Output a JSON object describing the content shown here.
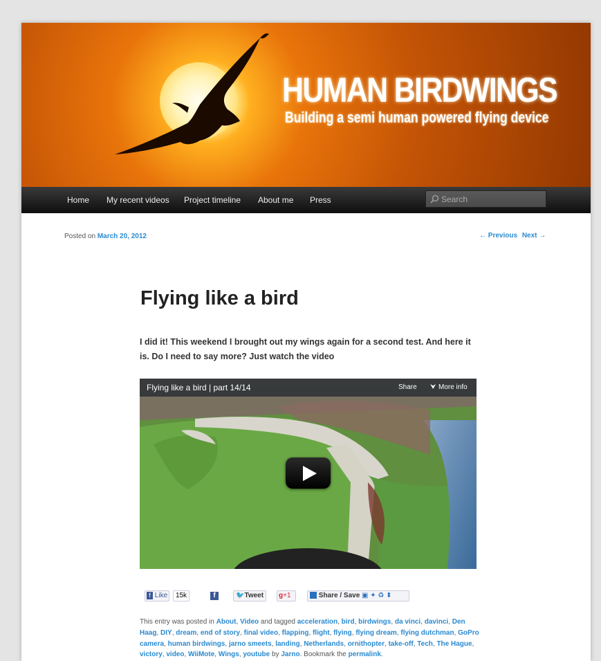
{
  "header": {
    "site_title": "HUMAN BIRDWINGS",
    "site_description": "Building a semi human powered flying device"
  },
  "nav": {
    "items": [
      "Home",
      "My recent videos",
      "Project timeline",
      "About me",
      "Press"
    ],
    "search_placeholder": "Search"
  },
  "post": {
    "posted_on_label": "Posted on",
    "date": "March 20, 2012",
    "previous": "← Previous",
    "next": "Next →",
    "title": "Flying like a bird",
    "intro": "I did it! This weekend I brought out my wings again for a second test. And here it is. Do I need to say more? Just watch the video"
  },
  "video": {
    "title": "Flying like a bird | part 14/14",
    "share": "Share",
    "more_info": "More info"
  },
  "social": {
    "like": "Like",
    "like_count": "15k",
    "tweet": "Tweet",
    "gplus": "+1",
    "share_save": "Share / Save"
  },
  "meta": {
    "text_1": "This entry was posted in",
    "categories": [
      "About",
      "Video"
    ],
    "and": "and",
    "text_2": "and tagged",
    "tags": [
      "acceleration",
      "bird",
      "birdwings",
      "da vinci",
      "davinci",
      "Den Haag",
      "DIY",
      "dream",
      "end of story",
      "final video",
      "flapping",
      "flight",
      "flying",
      "flying dream",
      "flying dutchman",
      "GoPro camera",
      "human birdwings",
      "jarno smeets",
      "landing",
      "Netherlands",
      "ornithopter",
      "take-off",
      "Tech",
      "The Hague",
      "victory",
      "video",
      "WiiMote",
      "Wings",
      "youtube"
    ],
    "by": "by",
    "author": "Jarno",
    "bookmark": ". Bookmark the",
    "permalink": "permalink",
    "end": "."
  }
}
